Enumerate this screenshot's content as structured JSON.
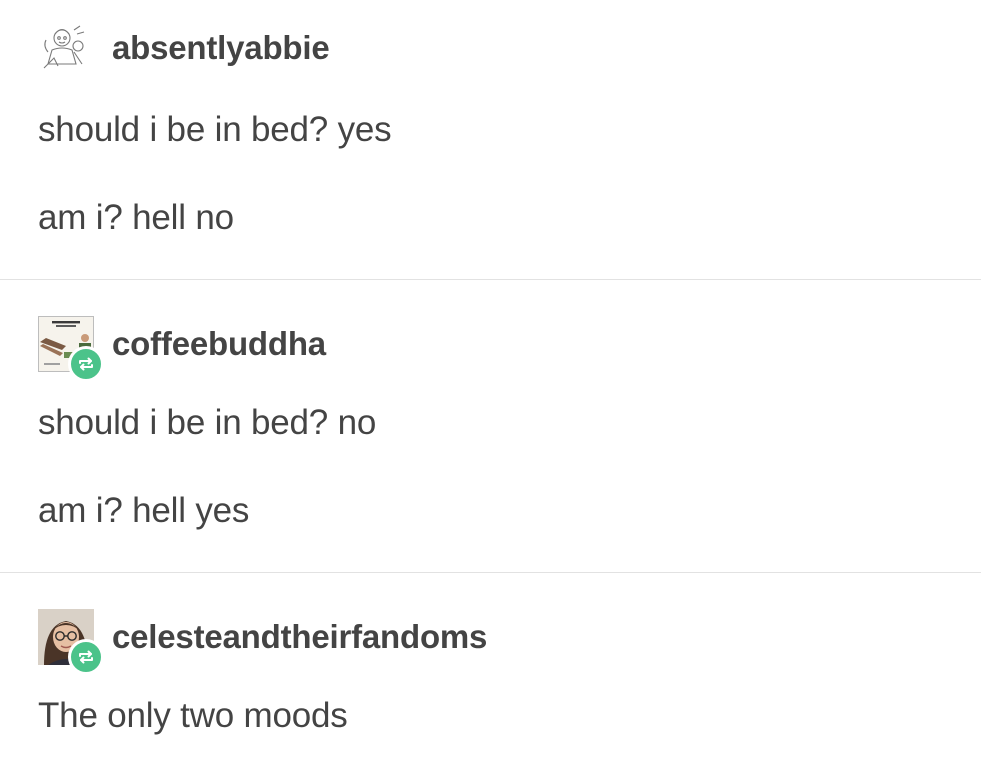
{
  "posts": [
    {
      "username": "absentlyabbie",
      "avatar_icon": "sketch-avatar-icon",
      "reblog": false,
      "lines": [
        "should i be in bed? yes",
        "am i? hell no"
      ]
    },
    {
      "username": "coffeebuddha",
      "avatar_icon": "movie-poster-avatar-icon",
      "reblog": true,
      "lines": [
        "should i be in bed? no",
        "am i? hell yes"
      ]
    },
    {
      "username": "celesteandtheirfandoms",
      "avatar_icon": "photo-avatar-icon",
      "reblog": true,
      "lines": [
        "The only two moods"
      ]
    }
  ],
  "colors": {
    "text": "#444444",
    "divider": "#e2e2e2",
    "reblog_badge": "#4bc38a",
    "background": "#ffffff"
  },
  "icons": {
    "reblog": "reblog-icon"
  }
}
